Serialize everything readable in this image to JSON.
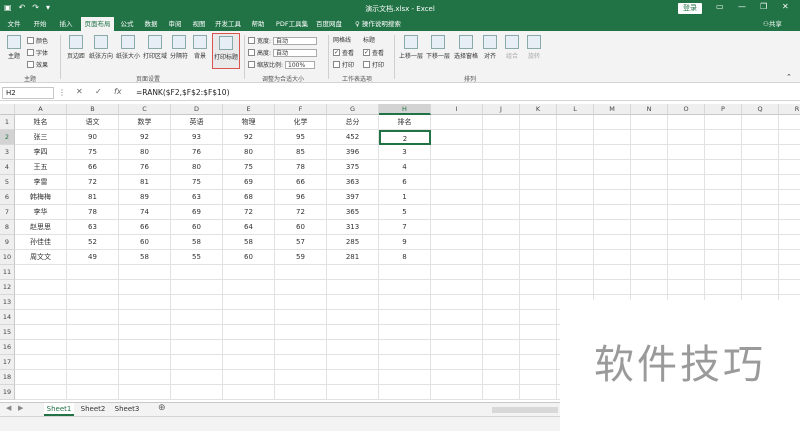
{
  "title_bar": {
    "doc_title": "演示文档.xlsx  -  Excel",
    "login": "登录"
  },
  "tabs": [
    "文件",
    "开始",
    "插入",
    "页面布局",
    "公式",
    "数据",
    "审阅",
    "视图",
    "开发工具",
    "帮助",
    "PDF工具集",
    "百度网盘"
  ],
  "active_tab": "页面布局",
  "tell_me": "操作说明搜索",
  "share": "共享",
  "ribbon": {
    "theme": {
      "label": "主题",
      "colors": "颜色",
      "fonts": "字体",
      "effects": "效果",
      "group": "主题"
    },
    "page_setup": {
      "margins": "页边距",
      "orientation": "纸张方向",
      "size": "纸张大小",
      "print_area": "打印区域",
      "breaks": "分隔符",
      "background": "背景",
      "print_titles": "打印标题",
      "group": "页面设置"
    },
    "scale": {
      "width_label": "宽度:",
      "width_val": "自动",
      "height_label": "高度:",
      "height_val": "自动",
      "scale_label": "缩放比例:",
      "scale_val": "100%",
      "group": "调整为合适大小"
    },
    "sheet_opts": {
      "gridlines": "网格线",
      "headings": "标题",
      "view1": "查看",
      "view2": "查看",
      "print1": "打印",
      "print2": "打印",
      "group": "工作表选项"
    },
    "arrange": {
      "bring_forward": "上移一层",
      "send_backward": "下移一层",
      "selection_pane": "选择窗格",
      "align": "对齐",
      "group_btn": "组合",
      "rotate": "旋转",
      "group": "排列"
    }
  },
  "formula_bar": {
    "name_box": "H2",
    "fx": "fx",
    "formula": "=RANK($F2,$F$2:$F$10)"
  },
  "columns": [
    "A",
    "B",
    "C",
    "D",
    "E",
    "F",
    "G",
    "H",
    "I",
    "J",
    "K",
    "L",
    "M",
    "N",
    "O",
    "P",
    "Q",
    "R"
  ],
  "rows": [
    [
      "姓名",
      "语文",
      "数学",
      "英语",
      "物理",
      "化学",
      "总分",
      "排名"
    ],
    [
      "张三",
      "90",
      "92",
      "93",
      "92",
      "95",
      "452",
      "2"
    ],
    [
      "李四",
      "75",
      "80",
      "76",
      "80",
      "85",
      "396",
      "3"
    ],
    [
      "王五",
      "66",
      "76",
      "80",
      "75",
      "78",
      "375",
      "4"
    ],
    [
      "李雷",
      "72",
      "81",
      "75",
      "69",
      "66",
      "363",
      "6"
    ],
    [
      "韩梅梅",
      "81",
      "89",
      "63",
      "68",
      "96",
      "397",
      "1"
    ],
    [
      "李华",
      "78",
      "74",
      "69",
      "72",
      "72",
      "365",
      "5"
    ],
    [
      "赵思思",
      "63",
      "66",
      "60",
      "64",
      "60",
      "313",
      "7"
    ],
    [
      "孙佳佳",
      "52",
      "60",
      "58",
      "58",
      "57",
      "285",
      "9"
    ],
    [
      "周文文",
      "49",
      "58",
      "55",
      "60",
      "59",
      "281",
      "8"
    ]
  ],
  "row_numbers": [
    "1",
    "2",
    "3",
    "4",
    "5",
    "6",
    "7",
    "8",
    "9",
    "10",
    "11",
    "12",
    "13",
    "14",
    "15",
    "16",
    "17",
    "18",
    "19"
  ],
  "sheets": [
    "Sheet1",
    "Sheet2",
    "Sheet3"
  ],
  "active_sheet": "Sheet1",
  "watermark": "软件技巧",
  "colors": {
    "accent": "#217346",
    "highlight": "#d9534f"
  }
}
